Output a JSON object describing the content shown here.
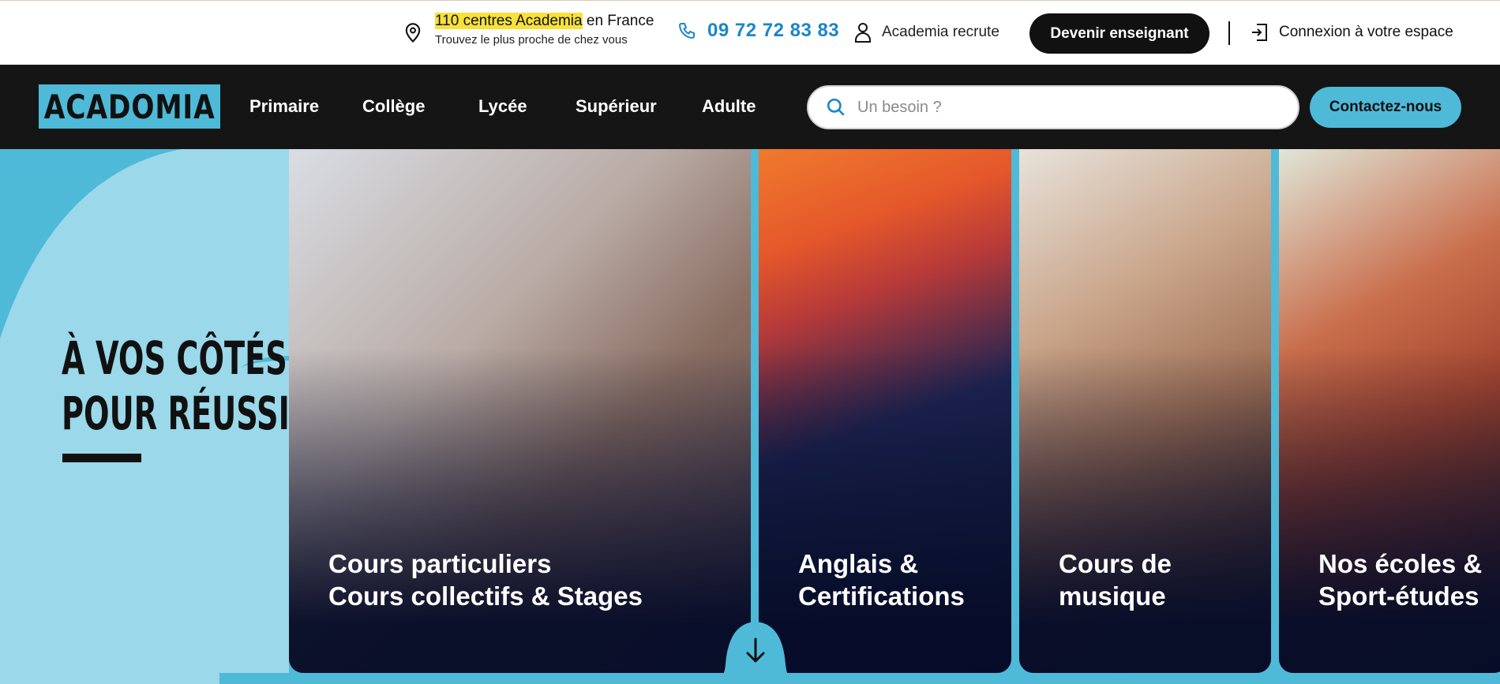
{
  "topbar": {
    "centres_highlight": "110 centres Academia",
    "centres_rest": " en France",
    "centres_sub": "Trouvez le plus proche de chez vous",
    "phone": "09 72 72 83 83",
    "recrute": "Academia recrute",
    "devenir_enseignant": "Devenir enseignant",
    "connexion": "Connexion à votre espace",
    "icons": {
      "location": "map-pin-icon",
      "phone": "phone-icon",
      "recrute": "user-icon",
      "connexion": "login-icon"
    }
  },
  "nav": {
    "logo": "ACADOMIA",
    "items": [
      "Primaire",
      "Collège",
      "Lycée",
      "Supérieur",
      "Adulte"
    ],
    "search_placeholder": "Un besoin ?",
    "contact": "Contactez-nous"
  },
  "hero": {
    "title_line1": "À VOS CÔTÉS",
    "title_line2": "POUR RÉUSSIR",
    "cards": [
      {
        "line1": "Cours particuliers",
        "line2": "Cours collectifs & Stages"
      },
      {
        "line1": "Anglais &",
        "line2": "Certifications"
      },
      {
        "line1": "Cours de",
        "line2": "musique"
      },
      {
        "line1": "Nos écoles &",
        "line2": "Sport-études"
      }
    ]
  },
  "colors": {
    "brand_blue": "#4fb9d8",
    "light_blue": "#9ad8ea",
    "dark": "#151515",
    "phone_blue": "#1c86c9",
    "highlight_yellow": "#f7e13a"
  }
}
